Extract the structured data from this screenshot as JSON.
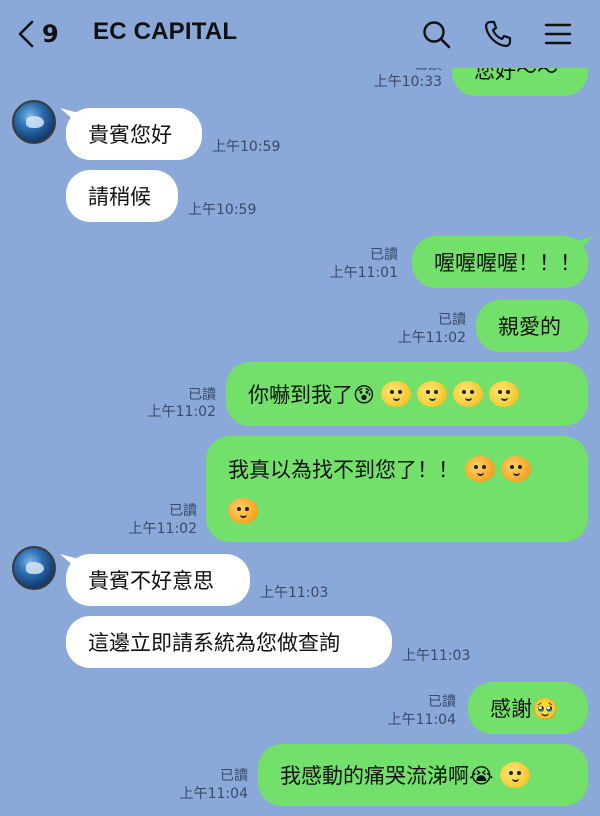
{
  "header": {
    "unread_count": "9",
    "title": "EC CAPITAL",
    "icons": [
      "back-chevron-icon",
      "search-icon",
      "phone-icon",
      "menu-icon"
    ]
  },
  "messages": [
    {
      "side": "out",
      "text": "您好～～",
      "read": "已讀",
      "time": "上午10:33"
    },
    {
      "side": "in",
      "text": "貴賓您好",
      "time": "上午10:59"
    },
    {
      "side": "in",
      "text": "請稍候",
      "time": "上午10:59"
    },
    {
      "side": "out",
      "text": "喔喔喔喔！！！",
      "read": "已讀",
      "time": "上午11:01"
    },
    {
      "side": "out",
      "text": "親愛的",
      "read": "已讀",
      "time": "上午11:02"
    },
    {
      "side": "out",
      "text": "你嚇到我了😰",
      "read": "已讀",
      "time": "上午11:02"
    },
    {
      "side": "out",
      "text": "我真以為找不到您了！！",
      "read": "已讀",
      "time": "上午11:02"
    },
    {
      "side": "in",
      "text": "貴賓不好意思",
      "time": "上午11:03"
    },
    {
      "side": "in",
      "text": "這邊立即請系統為您做查詢",
      "time": "上午11:03"
    },
    {
      "side": "out",
      "text": "感謝🥹",
      "read": "已讀",
      "time": "上午11:04"
    },
    {
      "side": "out",
      "text": "我感動的痛哭流涕啊😭",
      "read": "已讀",
      "time": "上午11:04"
    }
  ],
  "colors": {
    "background": "#8aa8d8",
    "outgoing_bubble": "#72e06a",
    "incoming_bubble": "#ffffff"
  }
}
